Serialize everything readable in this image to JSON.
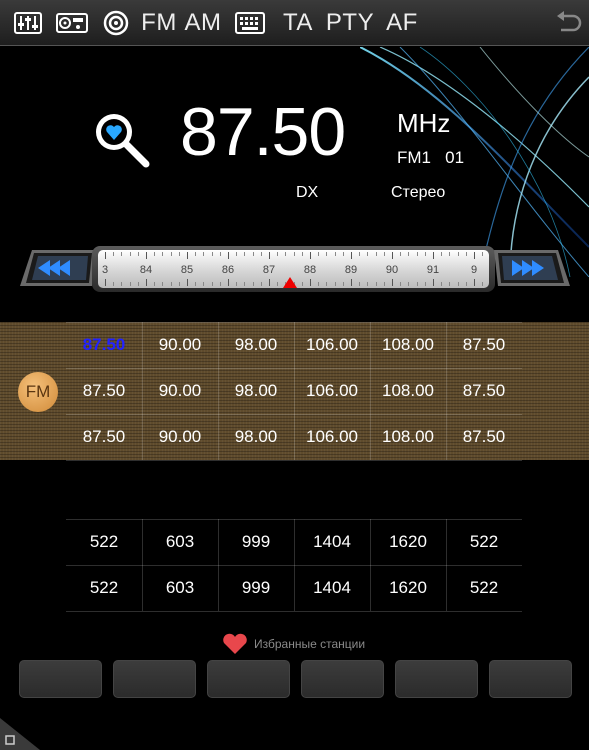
{
  "toolbar": {
    "items": [
      {
        "name": "equalizer-icon"
      },
      {
        "name": "radio-device-icon"
      },
      {
        "name": "scan-icon"
      },
      {
        "label": "FM"
      },
      {
        "label": "AM"
      },
      {
        "name": "keyboard-icon"
      },
      {
        "label": "TA"
      },
      {
        "label": "PTY"
      },
      {
        "label": "AF"
      },
      {
        "name": "back-icon"
      }
    ]
  },
  "display": {
    "frequency": "87.50",
    "unit": "MHz",
    "band": "FM1",
    "preset_number": "01",
    "dx": "DX",
    "stereo": "Стерео"
  },
  "tuner": {
    "labels": [
      "3",
      "84",
      "85",
      "86",
      "87",
      "88",
      "89",
      "90",
      "91",
      "9"
    ],
    "needle_frequency": 87.5
  },
  "fm": {
    "badge": "FM",
    "rows": [
      [
        "87.50",
        "90.00",
        "98.00",
        "106.00",
        "108.00",
        "87.50"
      ],
      [
        "87.50",
        "90.00",
        "98.00",
        "106.00",
        "108.00",
        "87.50"
      ],
      [
        "87.50",
        "90.00",
        "98.00",
        "106.00",
        "108.00",
        "87.50"
      ]
    ],
    "active_preset": "87.50"
  },
  "am": {
    "rows": [
      [
        "522",
        "603",
        "999",
        "1404",
        "1620",
        "522"
      ],
      [
        "522",
        "603",
        "999",
        "1404",
        "1620",
        "522"
      ]
    ]
  },
  "favorites": {
    "label": "Избранные станции",
    "slot_count": 6
  },
  "colors": {
    "active_preset": "#2222ff",
    "heart": "#e8474c",
    "panel": "#5f4b2c",
    "fm_badge": "#e0a050",
    "needle": "#ee0000"
  }
}
